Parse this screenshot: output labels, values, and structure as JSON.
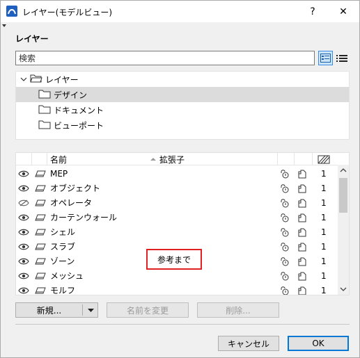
{
  "window": {
    "title": "レイヤー(モデルビュー)",
    "help_label": "?",
    "close_label": "✕"
  },
  "section": {
    "title": "レイヤー"
  },
  "search": {
    "placeholder": "検索"
  },
  "tree": {
    "items": [
      {
        "label": "レイヤー",
        "expanded": true,
        "level": 0
      },
      {
        "label": "デザイン",
        "level": 1,
        "selected": true
      },
      {
        "label": "ドキュメント",
        "level": 1
      },
      {
        "label": "ビューポート",
        "level": 1
      }
    ]
  },
  "table": {
    "headers": {
      "name": "名前",
      "extension": "拡張子"
    },
    "rows": [
      {
        "name": "MEP",
        "visible": true,
        "value": "1"
      },
      {
        "name": "オブジェクト",
        "visible": true,
        "value": "1"
      },
      {
        "name": "オペレータ",
        "visible": false,
        "value": "1"
      },
      {
        "name": "カーテンウォール",
        "visible": true,
        "value": "1"
      },
      {
        "name": "シェル",
        "visible": true,
        "value": "1"
      },
      {
        "name": "スラブ",
        "visible": true,
        "value": "1"
      },
      {
        "name": "ゾーン",
        "visible": true,
        "value": "1"
      },
      {
        "name": "メッシュ",
        "visible": true,
        "value": "1"
      },
      {
        "name": "モルフ",
        "visible": true,
        "value": "1"
      }
    ]
  },
  "annotation": {
    "text": "参考まで"
  },
  "buttons": {
    "new": "新規...",
    "rename": "名前を変更",
    "delete": "削除...",
    "cancel": "キャンセル",
    "ok": "OK"
  },
  "colors": {
    "accent": "#0078d7",
    "selection": "#dcdcdc",
    "annotation_border": "#e02020"
  }
}
